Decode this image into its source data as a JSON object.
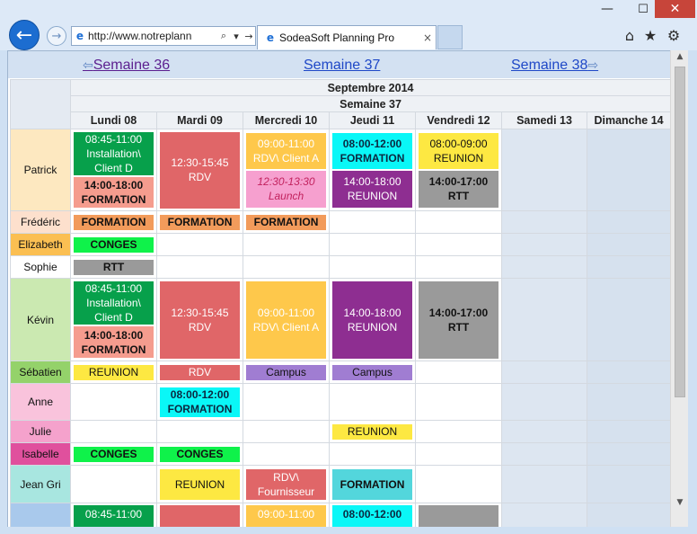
{
  "window": {
    "minimize_glyph": "—",
    "maximize_glyph": "☐",
    "close_glyph": "✕"
  },
  "browser": {
    "back_glyph": "←",
    "forward_glyph": "→",
    "address": "http://www.notreplann",
    "search_glyph": "⌕",
    "dropdown_glyph": "▾",
    "refresh_glyph": "→",
    "tab_title": "SodeaSoft Planning Pro",
    "tab_close": "×",
    "icons": [
      "home-icon",
      "star-icon",
      "gear-icon"
    ],
    "home_glyph": "⌂",
    "star_glyph": "★",
    "gear_glyph": "⚙",
    "ie_glyph": "e"
  },
  "nav": {
    "prev": "Semaine 36",
    "current": "Semaine 37",
    "next": "Semaine 38",
    "prev_arrow": "⇦",
    "next_arrow": "⇨"
  },
  "header": {
    "month": "Septembre 2014",
    "week": "Semaine 37",
    "days": [
      "Lundi 08",
      "Mardi 09",
      "Mercredi 10",
      "Jeudi 11",
      "Vendredi 12",
      "Samedi 13",
      "Dimanche 14"
    ]
  },
  "people": [
    {
      "name": "Patrick",
      "color": "#fde8c0"
    },
    {
      "name": "Frédéric",
      "color": "#fde0cd"
    },
    {
      "name": "Elizabeth",
      "color": "#fbbf52"
    },
    {
      "name": "Sophie",
      "color": "#ffffff"
    },
    {
      "name": "Kévin",
      "color": "#cbe9b1"
    },
    {
      "name": "Sébatien",
      "color": "#94d26a"
    },
    {
      "name": "Anne",
      "color": "#f9c3dc"
    },
    {
      "name": "Julie",
      "color": "#f5a2cc"
    },
    {
      "name": "Isabelle",
      "color": "#e0509d"
    },
    {
      "name": "Jean Gri",
      "color": "#a8e6e0"
    }
  ],
  "events": {
    "patrick": {
      "lundi_1": "08:45-11:00\nInstallation\\\nClient D",
      "lundi_2": "14:00-18:00\nFORMATION",
      "mardi_1": "12:30-15:45\nRDV",
      "mercredi_1": "09:00-11:00\nRDV\\ Client A",
      "mercredi_2": "12:30-13:30\nLaunch",
      "jeudi_1": "08:00-12:00\nFORMATION",
      "jeudi_2": "14:00-18:00\nREUNION",
      "vendredi_1": "08:00-09:00\nREUNION",
      "vendredi_2": "14:00-17:00\nRTT"
    },
    "frederic": {
      "lundi": "FORMATION",
      "mardi": "FORMATION",
      "mercredi": "FORMATION"
    },
    "elizabeth": {
      "lundi": "CONGES"
    },
    "sophie": {
      "lundi": "RTT"
    },
    "kevin": {
      "lundi_1": "08:45-11:00\nInstallation\\\nClient D",
      "lundi_2": "14:00-18:00\nFORMATION",
      "mardi_1": "12:30-15:45\nRDV",
      "mercredi_1": "09:00-11:00\nRDV\\ Client A",
      "jeudi_1": "14:00-18:00\nREUNION",
      "vendredi_1": "14:00-17:00\nRTT"
    },
    "sebatien": {
      "lundi": "REUNION",
      "mardi": "RDV",
      "mercredi": "Campus",
      "jeudi": "Campus"
    },
    "anne": {
      "mardi": "08:00-12:00\nFORMATION"
    },
    "julie": {
      "jeudi": "REUNION"
    },
    "isabelle": {
      "lundi": "CONGES",
      "mardi": "CONGES"
    },
    "jean": {
      "mardi": "REUNION",
      "mercredi": "RDV\\\nFournisseur",
      "jeudi": "FORMATION"
    },
    "next": {
      "lundi": "08:45-11:00",
      "mercredi": "09:00-11:00",
      "jeudi": "08:00-12:00"
    }
  },
  "scroll": {
    "up_glyph": "▲",
    "down_glyph": "▼"
  }
}
